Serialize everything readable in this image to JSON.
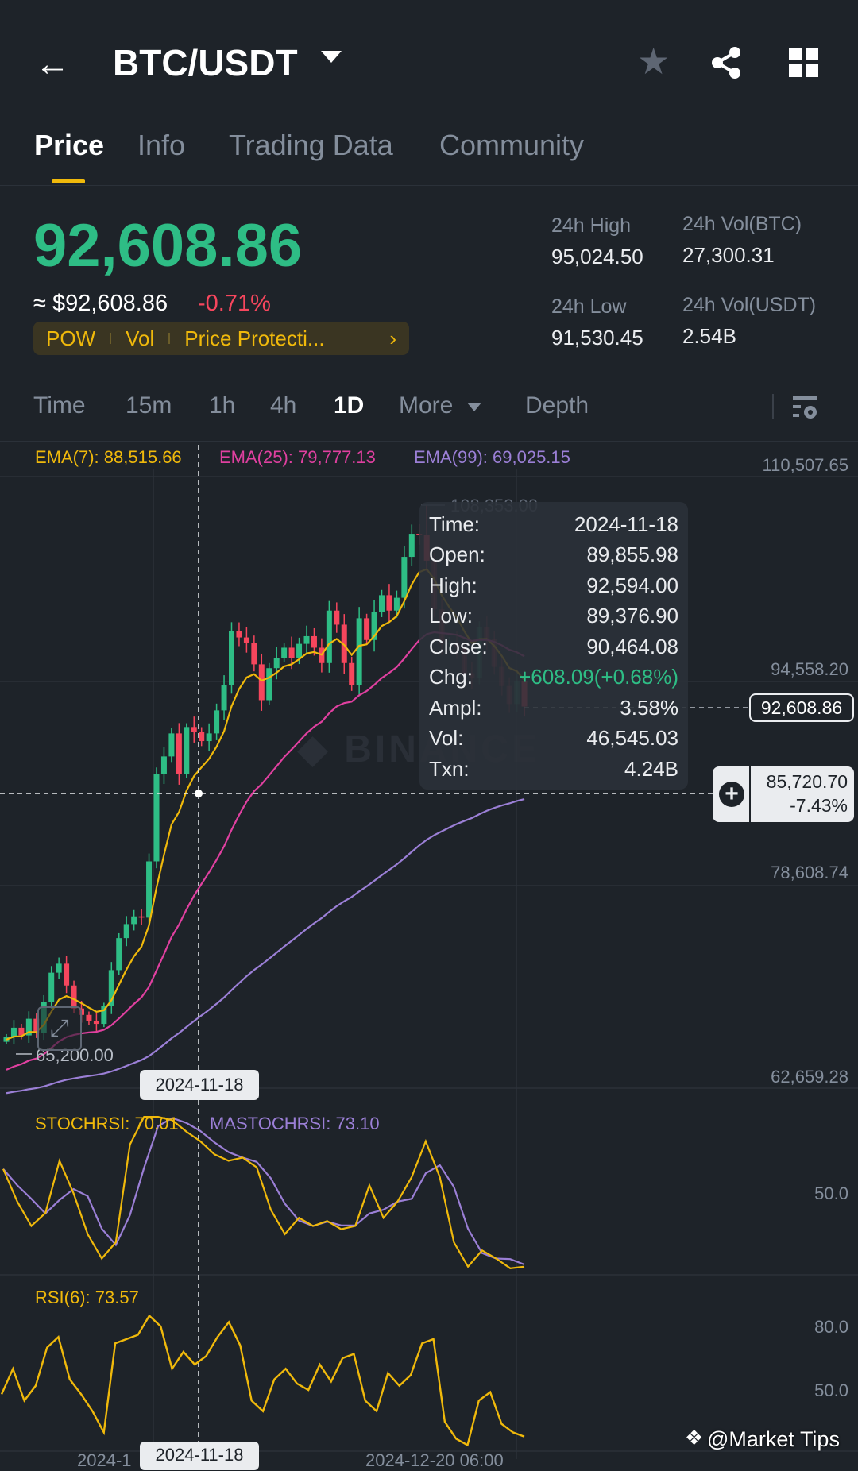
{
  "header": {
    "title": "BTC/USDT"
  },
  "tabs": [
    "Price",
    "Info",
    "Trading Data",
    "Community"
  ],
  "ticker": {
    "last": "92,608.86",
    "usd": "≈ $92,608.86",
    "change": "-0.71%",
    "tags": [
      "POW",
      "Vol",
      "Price Protecti..."
    ],
    "high_label": "24h High",
    "high": "95,024.50",
    "low_label": "24h Low",
    "low": "91,530.45",
    "volbtc_label": "24h Vol(BTC)",
    "volbtc": "27,300.31",
    "volusdt_label": "24h Vol(USDT)",
    "volusdt": "2.54B"
  },
  "timeframes": [
    "Time",
    "15m",
    "1h",
    "4h",
    "1D",
    "More",
    "Depth"
  ],
  "ema": {
    "ema7": "EMA(7): 88,515.66",
    "ema25": "EMA(25): 79,777.13",
    "ema99": "EMA(99): 69,025.15"
  },
  "axis": {
    "y1": "110,507.65",
    "y2": "94,558.20",
    "y3": "78,608.74",
    "y4": "62,659.28",
    "current": "92,608.86",
    "cross_price": "85,720.70",
    "cross_pct": "-7.43%",
    "max_label": "108,353.00",
    "min_label": "65,200.00",
    "cross_date": "2024-11-18",
    "x_left": "2024-1",
    "x_right": "2024-12-20 06:00"
  },
  "tooltip": [
    [
      "Time:",
      "2024-11-18"
    ],
    [
      "Open:",
      "89,855.98"
    ],
    [
      "High:",
      "92,594.00"
    ],
    [
      "Low:",
      "89,376.90"
    ],
    [
      "Close:",
      "90,464.08"
    ],
    [
      "Chg:",
      "+608.09(+0.68%)"
    ],
    [
      "Ampl:",
      "3.58%"
    ],
    [
      "Vol:",
      "46,545.03"
    ],
    [
      "Txn:",
      "4.24B"
    ]
  ],
  "stoch": {
    "label": "STOCHRSI: 70.01",
    "ma_label": "MASTOCHRSI: 73.10",
    "level": "50.0",
    "values": [
      65,
      45,
      30,
      38,
      70,
      50,
      25,
      10,
      20,
      80,
      97,
      97,
      95,
      88,
      82,
      74,
      70,
      72,
      66,
      40,
      25,
      35,
      30,
      33,
      28,
      30,
      55,
      35,
      45,
      60,
      82,
      60,
      20,
      5,
      15,
      10,
      4,
      5
    ]
  },
  "rsi": {
    "label": "RSI(6): 73.57",
    "level_high": "80.0",
    "level_mid": "50.0",
    "values": [
      48,
      60,
      45,
      52,
      70,
      75,
      55,
      48,
      40,
      30,
      72,
      74,
      76,
      85,
      80,
      60,
      68,
      62,
      66,
      75,
      82,
      71,
      45,
      40,
      55,
      60,
      53,
      50,
      62,
      54,
      65,
      67,
      45,
      40,
      58,
      52,
      57,
      72,
      74,
      35,
      27,
      24,
      45,
      49,
      34,
      30,
      28
    ]
  },
  "candles": {
    "closes": [
      66800,
      67500,
      66900,
      68200,
      67100,
      69500,
      71800,
      72500,
      70800,
      69000,
      68500,
      68000,
      67800,
      69200,
      72000,
      74500,
      75600,
      76200,
      76100,
      80500,
      87300,
      88700,
      90500,
      87300,
      91000,
      90600,
      89900,
      90500,
      92300,
      94300,
      98500,
      98000,
      97600,
      95900,
      93100,
      95600,
      96400,
      97200,
      96400,
      97500,
      98100,
      97200,
      96000,
      100100,
      99000,
      96000,
      94300,
      99500,
      97800,
      100000,
      101300,
      100100,
      101100,
      104300,
      106100,
      106000,
      104000,
      100200,
      97500,
      97600,
      97200,
      95200,
      94800,
      98800,
      97900,
      95700,
      94200,
      92800,
      94600,
      92600
    ]
  },
  "colors": {
    "up": "#2ebd85",
    "down": "#f6465d",
    "accent": "#f0b90b",
    "ema25": "#e040a0",
    "ema99": "#9b7fd6"
  },
  "watermark": "@Market Tips"
}
